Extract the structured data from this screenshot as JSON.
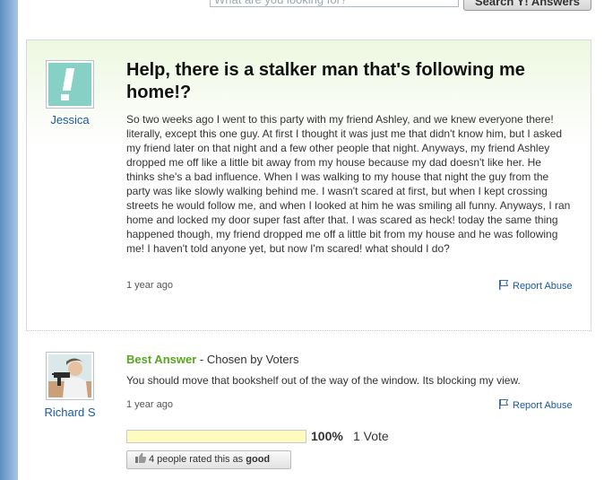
{
  "header": {
    "search_placeholder": "What are you looking for?",
    "search_button_label": "Search Y! Answers"
  },
  "question": {
    "asker": "Jessica",
    "title": "Help, there is a stalker man that's following me home!?",
    "body": "So two weeks ago I went to this party with my friend Ashley, and we knew everyone there! literally, except this one guy. At first I thought it was just me that didn't know him, but I asked my friend later on that night and a few other people that night. Anyways, my friend Ashley dropped me off like a little bit away from my house because my dad doesn't like her. He thinks she's a bad influence. When I was walking to my house that night the guy from the party was like slowly walking behind me. I wasn't scared at first, but when I kept crossing streets he would follow me, and when I looked at him he was smiling all funny. Anyways, I ran home and locked my door super fast after that. I was scared as heck! today the same thing happened though, my friend dropped me off a little bit from my house and he was following me! I haven't told anyone yet, but now I'm scared! what should I do?",
    "time": "1 year ago",
    "report_label": "Report Abuse"
  },
  "answer": {
    "answerer": "Richard S",
    "best_label": "Best Answer",
    "chosen_label": " - Chosen by Voters",
    "body": "You should move that bookshelf out of the way of the window. Its blocking my view.",
    "time": "1 year ago",
    "report_label": "Report Abuse",
    "vote_fraction": 1.0,
    "vote_percent": "100%",
    "vote_count": "1 Vote",
    "rated_text": "4 people rated this as",
    "rated_good": "good"
  },
  "colors": {
    "accent_link": "#1b5aa0",
    "best_answer_green": "#59a61f",
    "vote_bar_fill": "#fffbbe"
  }
}
